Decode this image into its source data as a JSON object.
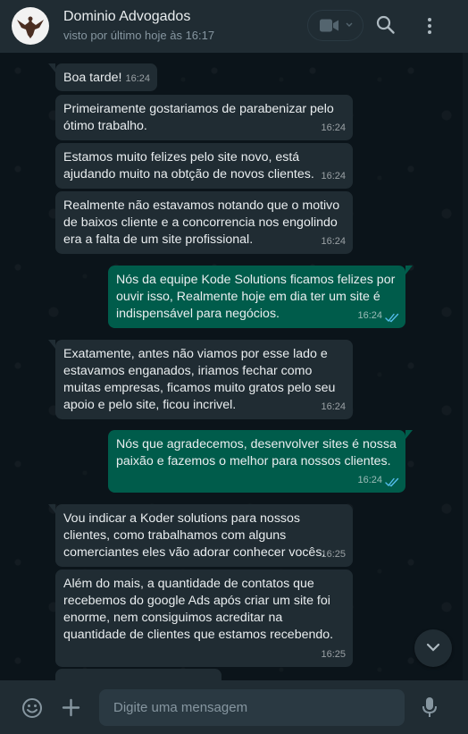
{
  "header": {
    "contact_name": "Dominio Advogados",
    "status": "visto por último hoje às 16:17",
    "avatar_icon": "eagle-logo-icon",
    "video_icon": "video-camera-icon",
    "search_icon": "search-icon",
    "menu_icon": "kebab-menu-icon"
  },
  "messages": [
    {
      "direction": "in",
      "text": "Boa tarde!",
      "time": "16:24"
    },
    {
      "direction": "in",
      "text": "Primeiramente gostariamos de parabenizar pelo ótimo trabalho.",
      "time": "16:24"
    },
    {
      "direction": "in",
      "text": "Estamos muito felizes pelo site novo, está ajudando muito na obtção de novos clientes.",
      "time": "16:24"
    },
    {
      "direction": "in",
      "text": "Realmente não estavamos notando que o motivo de baixos cliente e a concorrencia nos engolindo era a falta de um site profissional.",
      "time": "16:24"
    },
    {
      "direction": "out",
      "text": "Nós da equipe Kode Solutions ficamos felizes por ouvir isso, Realmente hoje em dia ter um site é indispensável para negócios.",
      "time": "16:24",
      "status": "read"
    },
    {
      "direction": "in",
      "text": "Exatamente, antes não viamos por esse lado e estavamos enganados, iriamos fechar como muitas empresas, ficamos muito gratos pelo seu apoio e pelo site, ficou incrivel.",
      "time": "16:24"
    },
    {
      "direction": "out",
      "text": "Nós que agradecemos, desenvolver sites é nossa paixão e fazemos o melhor para nossos clientes.",
      "time": "16:24",
      "status": "read"
    },
    {
      "direction": "in",
      "text": "Vou indicar a Koder solutions para nossos clientes, como trabalhamos com alguns comerciantes eles vão adorar conhecer vocês.",
      "time": "16:25"
    },
    {
      "direction": "in",
      "text": "Além do mais, a quantidade de contatos que recebemos do google Ads após criar um site foi enorme, nem consiguimos acreditar na quantidade de clientes que estamos recebendo.",
      "time": "16:25"
    }
  ],
  "composer": {
    "placeholder": "Digite uma mensagem",
    "emoji_icon": "emoji-icon",
    "attach_icon": "plus-icon",
    "mic_icon": "microphone-icon"
  },
  "colors": {
    "incoming_bubble": "#202c33",
    "outgoing_bubble": "#005c4b",
    "read_ticks": "#53bdeb"
  }
}
